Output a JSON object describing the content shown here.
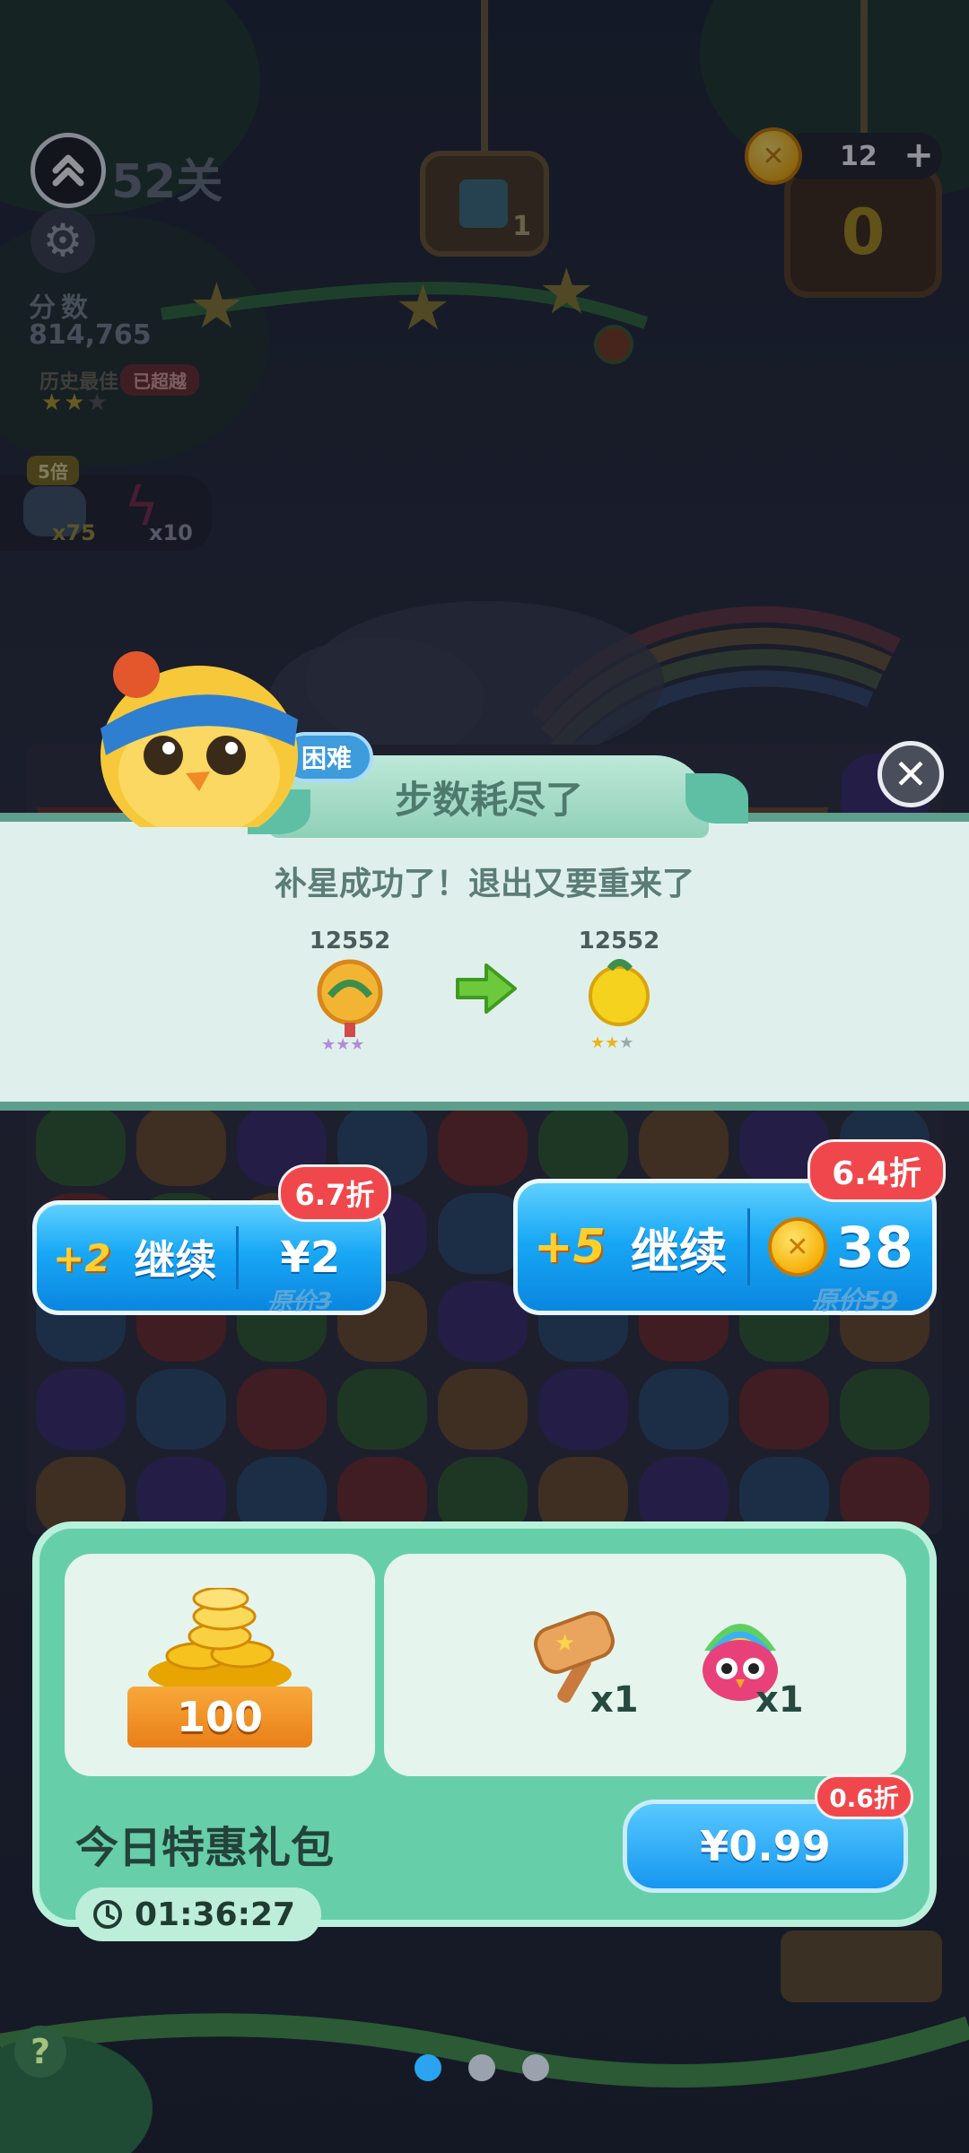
{
  "hud": {
    "level": "52关",
    "score_label": "分数",
    "score_value": "814,765",
    "record_label": "历史最佳",
    "record_badge": "已超越",
    "coins": "12",
    "coin_add": "+",
    "goal_count": "1",
    "goal_remaining": "0",
    "bonus_multiplier": "5倍",
    "bonus_item1_count": "x75",
    "bonus_item2_count": "x10",
    "icons": [
      "chevron-up-icon",
      "gear-icon",
      "coin-icon",
      "plus-icon"
    ]
  },
  "dialog": {
    "difficulty": "困难",
    "title": "步数耗尽了",
    "message": "补星成功了！退出又要重来了",
    "level_from": "12552",
    "level_to": "12552",
    "close_icon": "close-icon"
  },
  "continue_small": {
    "plus": "+2",
    "label": "继续",
    "price": "¥2",
    "original_price": "原价3",
    "discount": "6.7折"
  },
  "continue_large": {
    "plus": "+5",
    "label": "继续",
    "price": "38",
    "original_price": "原价59",
    "discount": "6.4折"
  },
  "gift_pack": {
    "title": "今日特惠礼包",
    "coins_amount": "100",
    "hammer_qty": "x1",
    "booster_qty": "x1",
    "price": "¥0.99",
    "discount": "0.6折",
    "timer": "01:36:27"
  },
  "pager": {
    "count": 3,
    "active": 0
  },
  "colors": {
    "accent_blue": "#19a8f5",
    "discount_red": "#f0474c",
    "gift_green": "#66cfa9",
    "banner_border": "#5e9e8c"
  }
}
